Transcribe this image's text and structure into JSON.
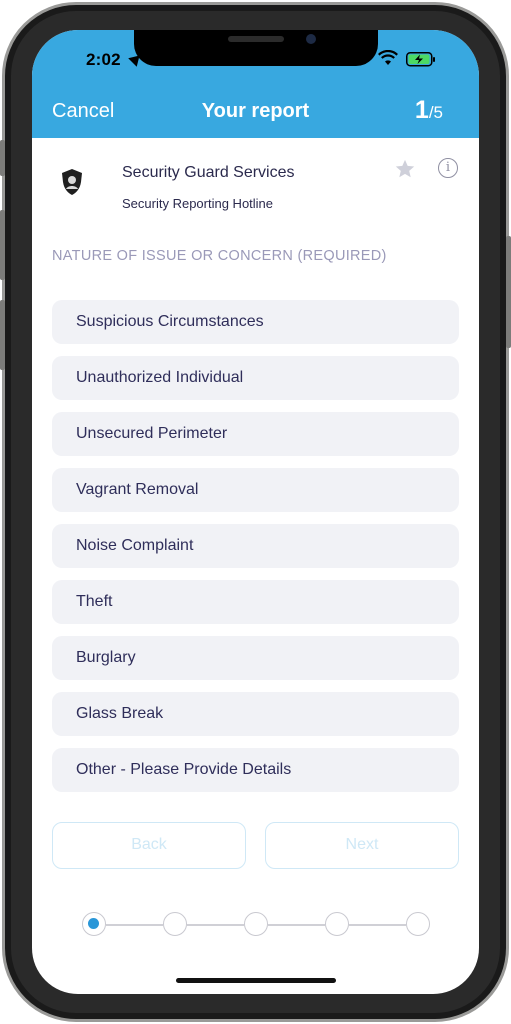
{
  "status_bar": {
    "time": "2:02"
  },
  "nav": {
    "cancel_label": "Cancel",
    "title": "Your report",
    "step_current": "1",
    "step_total": "/5"
  },
  "company": {
    "name": "Security Guard Services",
    "subtitle": "Security Reporting Hotline",
    "icons": {
      "logo": "shield-logo-icon",
      "favorite": "star-icon",
      "info": "info-icon"
    },
    "info_glyph": "i"
  },
  "section": {
    "label": "NATURE OF ISSUE OR CONCERN (REQUIRED)"
  },
  "options": [
    "Suspicious Circumstances",
    "Unauthorized Individual",
    "Unsecured Perimeter",
    "Vagrant Removal",
    "Noise Complaint",
    "Theft",
    "Burglary",
    "Glass Break",
    "Other - Please Provide Details"
  ],
  "buttons": {
    "back_label": "Back",
    "next_label": "Next"
  },
  "progress": {
    "total_steps": 5,
    "active_step": 1
  },
  "colors": {
    "header": "#38a8e0",
    "option_bg": "#f1f2f6",
    "active_dot": "#2a97d8",
    "disabled_button": "#cfe8f6"
  }
}
